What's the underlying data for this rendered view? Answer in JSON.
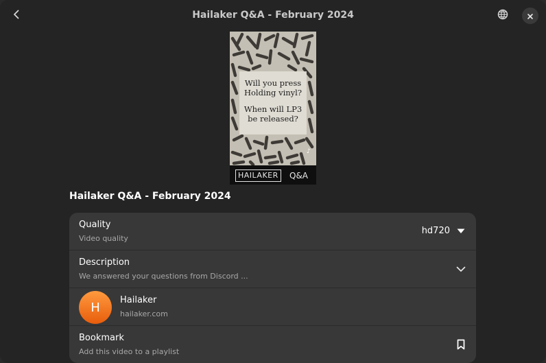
{
  "window": {
    "title": "Hailaker Q&A - February 2024"
  },
  "header": {
    "back_icon": "go-back-icon",
    "web_icon": "globe-icon",
    "close_icon": "close-icon"
  },
  "thumbnail": {
    "line1": "Will you press",
    "line2": "Holding vinyl?",
    "line3": "When will LP3",
    "line4": "be released?",
    "brand": "HAILAKER",
    "brand_suffix": "Q&A",
    "platform_mark": "♪"
  },
  "video": {
    "title": "Hailaker Q&A - February 2024"
  },
  "rows": {
    "quality": {
      "title": "Quality",
      "subtitle": "Video quality",
      "value": "hd720"
    },
    "description": {
      "title": "Description",
      "subtitle": "We answered your questions from Discord ..."
    },
    "author": {
      "initial": "H",
      "name": "Hailaker",
      "site": "hailaker.com"
    },
    "bookmark": {
      "title": "Bookmark",
      "subtitle": "Add this video to a playlist"
    }
  },
  "colors": {
    "window_bg": "#242424",
    "card_bg": "#383838",
    "avatar_top": "#ff9a3e",
    "avatar_bottom": "#e85d0c",
    "dim_text": "#a8a8a8"
  }
}
